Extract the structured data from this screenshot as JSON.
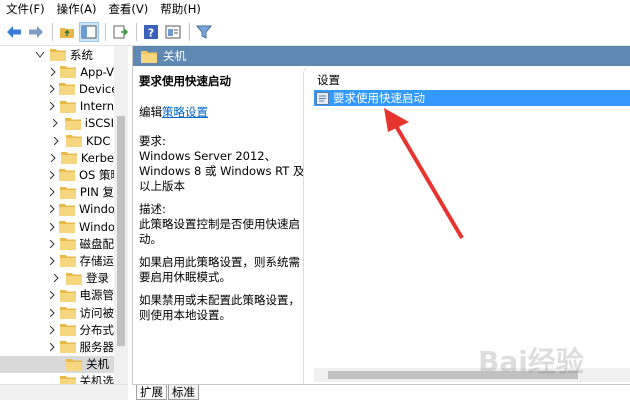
{
  "menu": {
    "file": "文件(F)",
    "action": "操作(A)",
    "view": "查看(V)",
    "help": "帮助(H)"
  },
  "toolbar": {
    "icons": [
      "back-icon",
      "forward-icon",
      "up-folder-icon",
      "show-hide-tree-icon",
      "export-list-icon",
      "help-icon",
      "properties-icon",
      "filter-icon"
    ]
  },
  "tree": {
    "root": "系统",
    "items": [
      "App-V",
      "Device",
      "Intern",
      "iSCSI",
      "KDC",
      "Kerbe",
      "OS 策略",
      "PIN 复",
      "Windo",
      "Windo",
      "磁盘配",
      "存储运",
      "登录",
      "电源管",
      "访问被",
      "分布式",
      "服务器",
      "关机",
      "关机选"
    ],
    "selected_index": 17
  },
  "pane": {
    "header_title": "关机",
    "desc": {
      "title": "要求使用快速启动",
      "edit_prefix": "编辑",
      "edit_link": "策略设置",
      "req_label": "要求:",
      "req_text": "Windows Server 2012、Windows 8 或 Windows RT 及以上版本",
      "desc_label": "描述:",
      "desc_text": "此策略设置控制是否使用快速启动。",
      "enabled_text": "如果启用此策略设置，则系统需要启用休眠模式。",
      "disabled_text": "如果禁用或未配置此策略设置，则使用本地设置。"
    },
    "list": {
      "column_header": "设置",
      "selected_setting": "要求使用快速启动"
    }
  },
  "tabs": {
    "extended": "扩展",
    "standard": "标准"
  },
  "colors": {
    "header_bg": "#5f89b3",
    "selection": "#3399ff",
    "arrow": "#e8342f"
  },
  "watermark": "Bai经验"
}
